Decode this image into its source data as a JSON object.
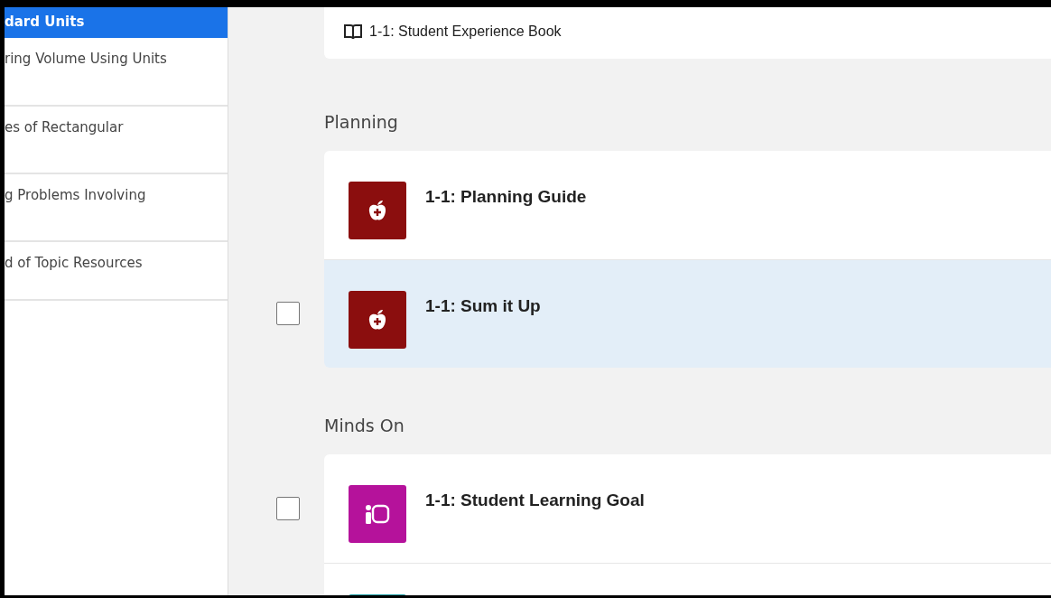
{
  "sidebar": {
    "items": [
      {
        "label": "dard Units",
        "selected": true
      },
      {
        "label": "ring Volume Using Units",
        "selected": false
      },
      {
        "label": "es of Rectangular",
        "selected": false
      },
      {
        "label": "g Problems Involving",
        "selected": false
      },
      {
        "label": "d of Topic Resources",
        "selected": false
      }
    ]
  },
  "resource_card": {
    "title": "1-1: Student Experience Book"
  },
  "sections": [
    {
      "heading": "Planning",
      "items": [
        {
          "title": "1-1: Planning Guide",
          "kind": "apple",
          "color": "#8b0e0e",
          "hovered": false
        },
        {
          "title": "1-1: Sum it Up",
          "kind": "apple",
          "color": "#8b0e0e",
          "hovered": true,
          "checkbox": {
            "checked": false
          }
        }
      ]
    },
    {
      "heading": "Minds On",
      "items": [
        {
          "title": "1-1: Student Learning Goal",
          "kind": "goal",
          "color": "#b5129b",
          "hovered": false,
          "checkbox": {
            "checked": false
          }
        },
        {
          "kind": "blank",
          "color": "#1a9aa0",
          "hovered": false
        }
      ]
    }
  ]
}
